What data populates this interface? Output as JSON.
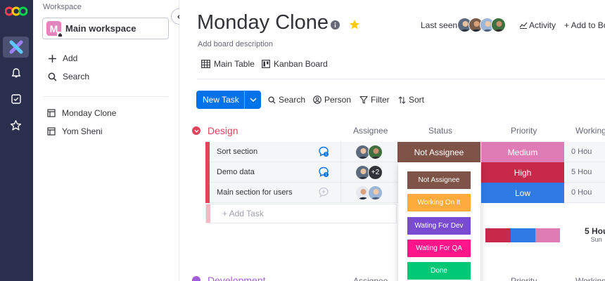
{
  "sidebar": {
    "workspace_label": "Workspace",
    "workspace_name": "Main workspace",
    "workspace_initial": "M",
    "actions": [
      {
        "label": "Add",
        "icon": "plus-icon"
      },
      {
        "label": "Search",
        "icon": "search-icon"
      }
    ],
    "boards": [
      {
        "label": "Monday Clone",
        "icon": "board-icon"
      },
      {
        "label": "Yom Sheni",
        "icon": "board-icon"
      }
    ]
  },
  "rail": {
    "icons": [
      "monday-logo",
      "workspace-icon",
      "bell-icon",
      "checkbox-icon",
      "star-icon"
    ]
  },
  "board": {
    "title": "Monday Clone",
    "description": "Add board description",
    "last_seen_label": "Last seen",
    "activity_label": "Activity",
    "add_to_board_label": "+ Add to Bo",
    "views": [
      {
        "label": "Main Table",
        "icon": "table-icon"
      },
      {
        "label": "Kanban Board",
        "icon": "kanban-icon"
      }
    ]
  },
  "toolbar": {
    "new_task_label": "New Task",
    "search_label": "Search",
    "person_label": "Person",
    "filter_label": "Filter",
    "sort_label": "Sort"
  },
  "columns": {
    "assignee": "Assignee",
    "status": "Status",
    "priority": "Priority",
    "working": "Working"
  },
  "groups": [
    {
      "name": "Design",
      "color": "#e2445c",
      "rows": [
        {
          "name": "Sort section",
          "status": "Not Assignee",
          "status_color": "#7f5347",
          "priority": "Medium",
          "priority_color": "#e07cb5",
          "working": "0 Hou"
        },
        {
          "name": "Demo data",
          "assignee_extra": "+2",
          "status": "",
          "status_color": "#ffffff",
          "priority": "High",
          "priority_color": "#c6294a",
          "working": "5 Hou"
        },
        {
          "name": "Main section for users",
          "status": "",
          "status_color": "#ffffff",
          "priority": "Low",
          "priority_color": "#2f7ae5",
          "working": "0 Hou"
        }
      ],
      "add_task_label": "+ Add Task",
      "summary": {
        "working_value": "5 Hou",
        "working_sub": "Sun"
      }
    },
    {
      "name": "Development",
      "color": "#a25ddc"
    }
  ],
  "status_dropdown": {
    "options": [
      {
        "label": "Not Assignee",
        "color": "#7f5347"
      },
      {
        "label": "Working On It",
        "color": "#fdab3d"
      },
      {
        "label": "Wating For Dev",
        "color": "#784bd1"
      },
      {
        "label": "Wating For QA",
        "color": "#ff158a"
      },
      {
        "label": "Done",
        "color": "#00c875"
      }
    ]
  }
}
